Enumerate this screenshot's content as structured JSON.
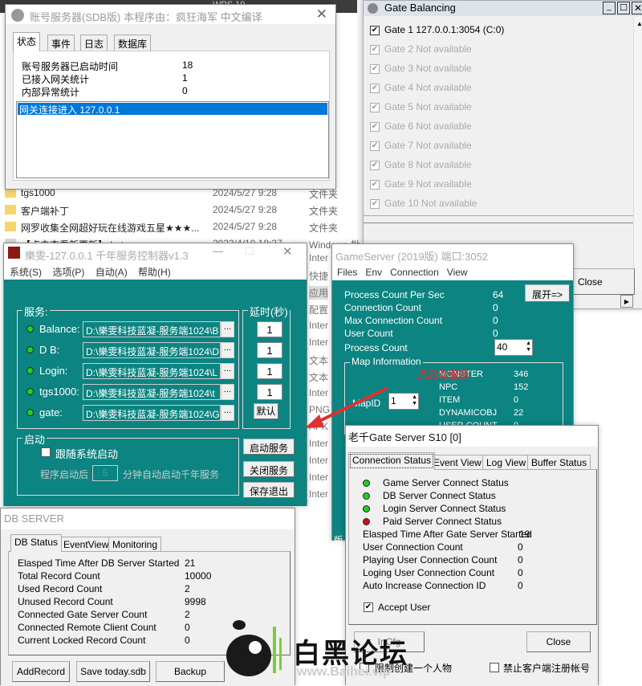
{
  "explorer": {
    "top_text": "WPS 19...",
    "files": [
      {
        "name": "tgs1000",
        "date": "2024/5/27 9:28",
        "type": "文件夹"
      },
      {
        "name": "客户端补丁",
        "date": "2024/5/27 9:28",
        "type": "文件夹"
      },
      {
        "name": "网罗收集全网超好玩在线游戏五星★★★...",
        "date": "2024/5/27 9:28",
        "type": "文件夹"
      },
      {
        "name": "【点击查看新更新】.bat",
        "date": "2023/4/10 18:37",
        "type": "Windows 批"
      }
    ],
    "type_column": [
      "Inter",
      "快捷",
      "应用",
      "配置",
      "Inter",
      "Inter",
      "文本",
      "文本",
      "Inter",
      "PNG",
      "APK",
      "Inter",
      "Inter",
      "Inter",
      "Inter"
    ]
  },
  "account_server": {
    "title": "账号服务器(SDB版)      本程序由：疯狂海军 中文编译",
    "tabs": [
      "状态",
      "事件",
      "日志",
      "数据库"
    ],
    "stats": [
      {
        "label": "账号服务器已启动时间",
        "value": "18"
      },
      {
        "label": "已接入网关统计",
        "value": "1"
      },
      {
        "label": "内部异常统计",
        "value": "0"
      }
    ],
    "log": [
      "网关连接进入 127.0.0.1"
    ]
  },
  "gate_balancing": {
    "title": "Gate Balancing",
    "gates": [
      {
        "label": "Gate 1 127.0.0.1:3054 (C:0)",
        "checked": true,
        "enabled": true
      },
      {
        "label": "Gate 2 Not available"
      },
      {
        "label": "Gate 3 Not available"
      },
      {
        "label": "Gate 4 Not available"
      },
      {
        "label": "Gate 5 Not available"
      },
      {
        "label": "Gate 6 Not available"
      },
      {
        "label": "Gate 7 Not available"
      },
      {
        "label": "Gate 8 Not available"
      },
      {
        "label": "Gate 9 Not available"
      },
      {
        "label": "Gate 10 Not available"
      }
    ],
    "close_label": "Close"
  },
  "controller": {
    "title": "樂雯-127.0.0.1   千年服务控制器v1.3",
    "menu": [
      "系统(S)",
      "选项(P)",
      "自动(A)",
      "帮助(H)"
    ],
    "services_label": "服务:",
    "delay_label": "延时(秒)",
    "services": [
      {
        "name": "Balance:",
        "path": "D:\\樂雯科技蓝凝-服务端1024\\B",
        "delay": "1"
      },
      {
        "name": "D B:",
        "path": "D:\\樂雯科技蓝凝-服务端1024\\D",
        "delay": "1"
      },
      {
        "name": "Login:",
        "path": "D:\\樂雯科技蓝凝-服务端1024\\L",
        "delay": "1"
      },
      {
        "name": "tgs1000:",
        "path": "D:\\樂雯科技蓝凝-服务端1024\\t",
        "delay": "1"
      },
      {
        "name": "gate:",
        "path": "D:\\樂雯科技蓝凝-服务端1024\\G"
      }
    ],
    "browse_label": "...",
    "default_label": "默认",
    "startup_label": "启动",
    "autostart_label": "跟随系统启动",
    "delay_prefix": "程序启动后",
    "delay_minutes": "5",
    "delay_suffix": "分钟自动启动千年服务",
    "start_label": "启动服务",
    "stop_label": "关闭服务",
    "save_exit_label": "保存退出"
  },
  "game_server": {
    "title": "GameServer (2019版) 端口:3052",
    "menu": [
      "Files",
      "Env",
      "Connection",
      "View"
    ],
    "expand_label": "展开=>",
    "stats": [
      {
        "label": "Process Count Per Sec",
        "value": "64"
      },
      {
        "label": "Connection Count",
        "value": "0"
      },
      {
        "label": "Max Connection Count",
        "value": "0"
      },
      {
        "label": "User Count",
        "value": "0"
      }
    ],
    "process_count_label": "Process Count",
    "process_count": "40",
    "map_info_label": "Map Information",
    "mapid_label": "MapID",
    "mapid": "1",
    "map_stats": [
      {
        "label": "MONSTER",
        "value": "346"
      },
      {
        "label": "NPC",
        "value": "152"
      },
      {
        "label": "ITEM",
        "value": "0"
      },
      {
        "label": "DYNAMICOBJ",
        "value": "22"
      },
      {
        "label": "USER COUNT",
        "value": "0"
      }
    ],
    "footer": "版"
  },
  "annotation": {
    "text": "点启动服务",
    "color": "#e03030"
  },
  "db_server": {
    "title": "DB SERVER",
    "tabs": [
      "DB Status",
      "EventView",
      "Monitoring"
    ],
    "stats": [
      {
        "label": "Elasped Time After DB Server Started",
        "value": "21"
      },
      {
        "label": "Total Record Count",
        "value": "10000"
      },
      {
        "label": "Used Record Count",
        "value": "2"
      },
      {
        "label": "Unused Record Count",
        "value": "9998"
      },
      {
        "label": "Connected Gate Server Count",
        "value": "2"
      },
      {
        "label": "Connected Remote Client Count",
        "value": "0"
      },
      {
        "label": "Current Locked Record Count",
        "value": "0"
      }
    ],
    "buttons": [
      "AddRecord",
      "Save today.sdb",
      "Backup"
    ]
  },
  "gate_server": {
    "title": "老千Gate Server S10 [0]",
    "tabs": [
      "Connection Status",
      "Event View",
      "Log View",
      "Buffer Status"
    ],
    "connections": [
      {
        "label": "Game Server Connect Status",
        "status": "green"
      },
      {
        "label": "DB Server Connect Status",
        "status": "green"
      },
      {
        "label": "Login Server Connect Status",
        "status": "green"
      },
      {
        "label": "Paid Server Connect Status",
        "status": "red"
      }
    ],
    "stats": [
      {
        "label": "Elasped Time After Gate Server Started",
        "value": "19"
      },
      {
        "label": "User Connection Count",
        "value": "0"
      },
      {
        "label": "Playing User Connection Count",
        "value": "0"
      },
      {
        "label": "Loging User Connection Count",
        "value": "0"
      },
      {
        "label": "Auto Increase Connection ID",
        "value": "0"
      }
    ],
    "accept_user_label": "Accept User",
    "left_button": "InCfg",
    "close_label": "Close",
    "limit_char_label": "限制创建一个人物",
    "no_register_label": "禁止客户端注册帐号"
  },
  "watermark": {
    "text": "白黑论坛",
    "url": "www.Baihei.vip"
  },
  "colors": {
    "teal": "#0c8481",
    "selection": "#0078d7",
    "green": "#22d022",
    "red": "#d01010"
  }
}
